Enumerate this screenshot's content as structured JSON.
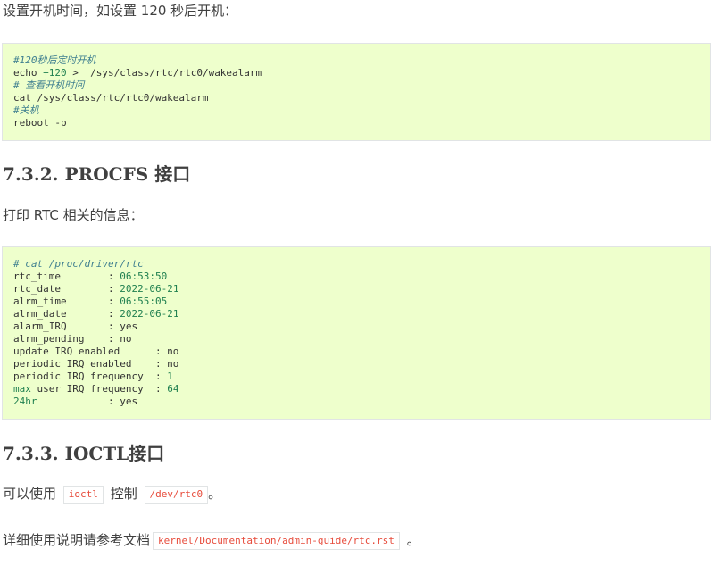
{
  "intro": {
    "text": "设置开机时间，如设置 120 秒后开机："
  },
  "block1": {
    "lines": [
      [
        {
          "t": "#120秒后定时开机",
          "k": "comment"
        }
      ],
      [
        {
          "t": "echo ",
          "k": "plain"
        },
        {
          "t": "+120",
          "k": "num"
        },
        {
          "t": " >  /sys/class/rtc/rtc0/wakealarm",
          "k": "plain"
        }
      ],
      [
        {
          "t": "# 查看开机时间",
          "k": "comment"
        }
      ],
      [
        {
          "t": "cat /sys/class/rtc/rtc0/wakealarm",
          "k": "plain"
        }
      ],
      [
        {
          "t": "#关机",
          "k": "comment"
        }
      ],
      [
        {
          "t": "reboot -p",
          "k": "plain"
        }
      ]
    ]
  },
  "section_procfs": {
    "heading": "7.3.2. PROCFS 接口",
    "text": "打印 RTC 相关的信息："
  },
  "block2": {
    "lines": [
      [
        {
          "t": "# cat /proc/driver/rtc",
          "k": "comment"
        }
      ],
      [
        {
          "t": "rtc_time        : ",
          "k": "plain"
        },
        {
          "t": "06:53:50",
          "k": "num"
        }
      ],
      [
        {
          "t": "rtc_date        : ",
          "k": "plain"
        },
        {
          "t": "2022-06-21",
          "k": "num"
        }
      ],
      [
        {
          "t": "alrm_time       : ",
          "k": "plain"
        },
        {
          "t": "06:55:05",
          "k": "num"
        }
      ],
      [
        {
          "t": "alrm_date       : ",
          "k": "plain"
        },
        {
          "t": "2022-06-21",
          "k": "num"
        }
      ],
      [
        {
          "t": "alarm_IRQ       : yes",
          "k": "plain"
        }
      ],
      [
        {
          "t": "alrm_pending    : no",
          "k": "plain"
        }
      ],
      [
        {
          "t": "update IRQ enabled      : no",
          "k": "plain"
        }
      ],
      [
        {
          "t": "periodic IRQ enabled    : no",
          "k": "plain"
        }
      ],
      [
        {
          "t": "periodic IRQ frequency  : ",
          "k": "plain"
        },
        {
          "t": "1",
          "k": "num"
        }
      ],
      [
        {
          "t": "max",
          "k": "num"
        },
        {
          "t": " user IRQ frequency  : ",
          "k": "plain"
        },
        {
          "t": "64",
          "k": "num"
        }
      ],
      [
        {
          "t": "24hr",
          "k": "num"
        },
        {
          "t": "            : yes",
          "k": "plain"
        }
      ]
    ]
  },
  "section_ioctl": {
    "heading": "7.3.3. IOCTL接口",
    "line1": {
      "prefix": "可以使用",
      "code1": "ioctl",
      "middle": "控制",
      "code2": "/dev/rtc0",
      "suffix": "。"
    },
    "line2": {
      "prefix": "详细使用说明请参考文档",
      "code": "kernel/Documentation/admin-guide/rtc.rst",
      "suffix": "。"
    }
  },
  "colors": {
    "code_background": "#eeffcc",
    "comment": "#408090",
    "number": "#208050",
    "inline_code_text": "#e74c3c",
    "body_text": "#404040"
  }
}
